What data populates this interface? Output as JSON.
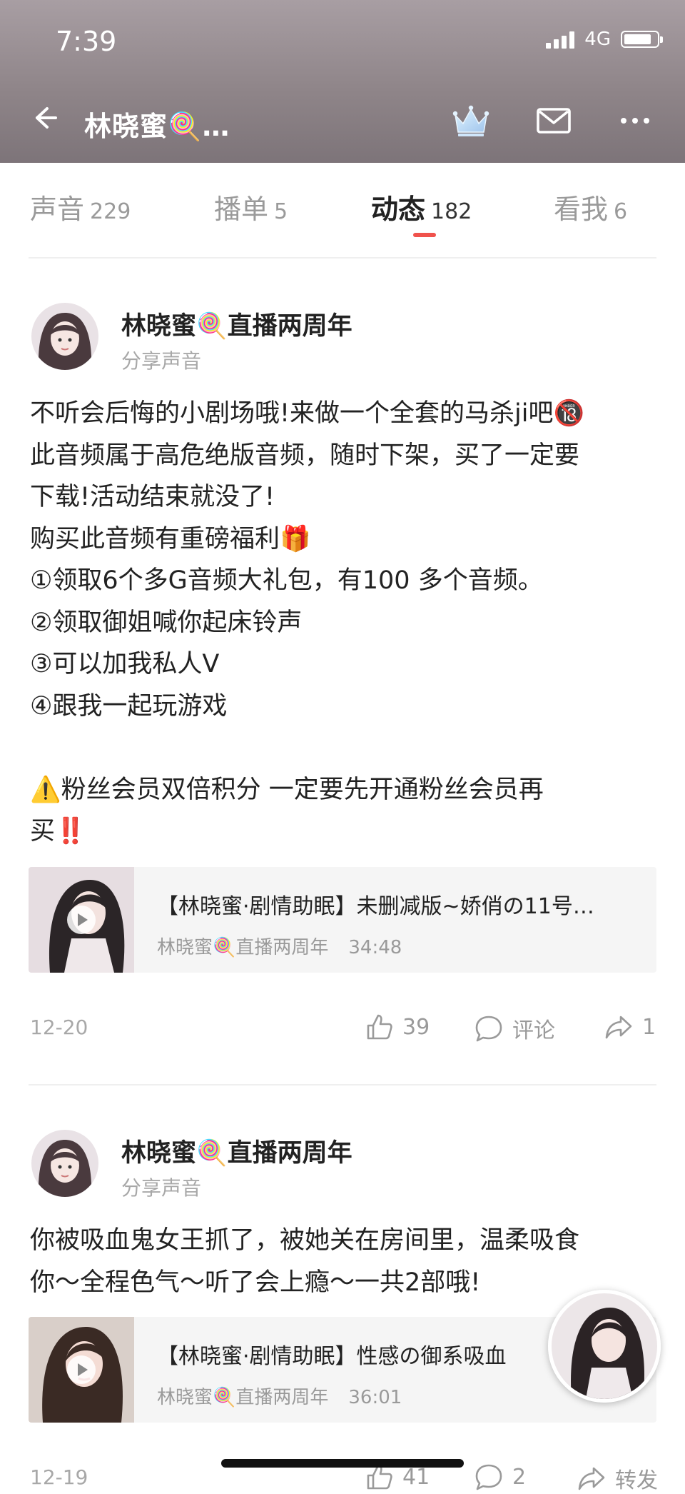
{
  "status_bar": {
    "time": "7:39",
    "network": "4G",
    "battery_level": 0.85
  },
  "header": {
    "title": "林晓蜜🍭…"
  },
  "tabs": [
    {
      "label": "声音",
      "count": "229"
    },
    {
      "label": "播单",
      "count": "5"
    },
    {
      "label": "动态",
      "count": "182",
      "active": true
    },
    {
      "label": "看我",
      "count": "6"
    }
  ],
  "posts": [
    {
      "author": "林晓蜜🍭直播两周年",
      "action": "分享声音",
      "text": "不听会后悔的小剧场哦!来做一个全套的马杀ji吧🔞\n此音频属于高危绝版音频，随时下架，买了一定要\n下载!活动结束就没了!\n购买此音频有重磅福利🎁\n①领取6个多G音频大礼包，有100 多个音频。\n②领取御姐喊你起床铃声\n③可以加我私人V\n④跟我一起玩游戏\n\n⚠️粉丝会员双倍积分 一定要先开通粉丝会员再\n买‼️",
      "card": {
        "title": "【林晓蜜·剧情助眠】未删减版~娇俏の11号…",
        "author": "林晓蜜🍭直播两周年",
        "duration": "34:48"
      },
      "date": "12-20",
      "likes": "39",
      "comment_label": "评论",
      "shares": "1"
    },
    {
      "author": "林晓蜜🍭直播两周年",
      "action": "分享声音",
      "text": "你被吸血鬼女王抓了，被她关在房间里，温柔吸食\n你～全程色气～听了会上瘾～一共2部哦!",
      "card": {
        "title": "【林晓蜜·剧情助眠】性感の御系吸血",
        "author": "林晓蜜🍭直播两周年",
        "duration": "36:01"
      },
      "date": "12-19",
      "likes": "41",
      "comments": "2",
      "share_label": "转发"
    }
  ],
  "colors": {
    "accent": "#f0524c",
    "header_bg": "#8f8589",
    "muted_text": "#a8a8a8"
  }
}
